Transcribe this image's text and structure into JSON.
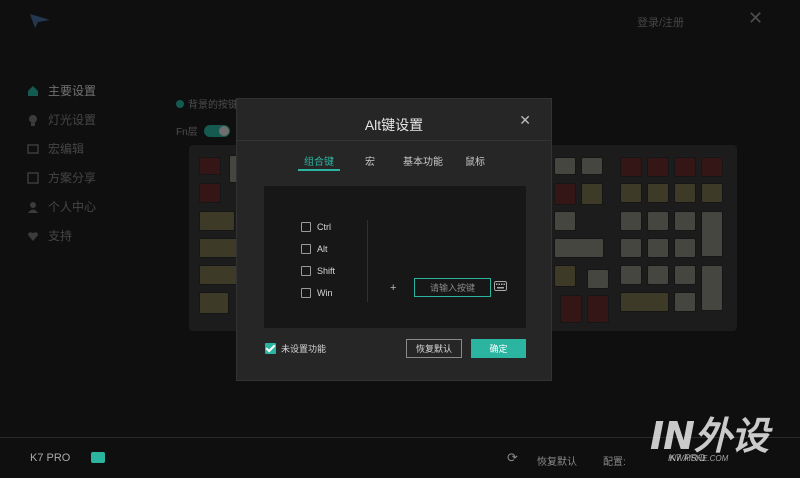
{
  "app": {
    "top_right_text": "登录/注册",
    "close_glyph": "✕"
  },
  "sidebar": {
    "items": [
      {
        "label": "主要设置",
        "icon": "home-icon",
        "active": true
      },
      {
        "label": "灯光设置",
        "icon": "light-icon",
        "active": false
      },
      {
        "label": "宏编辑",
        "icon": "macro-icon",
        "active": false
      },
      {
        "label": "方案分享",
        "icon": "share-icon",
        "active": false
      },
      {
        "label": "个人中心",
        "icon": "user-icon",
        "active": false
      },
      {
        "label": "支持",
        "icon": "support-icon",
        "active": false
      }
    ]
  },
  "options": {
    "backlight_label": "背景的按键",
    "fn_label": "Fn层"
  },
  "dialog": {
    "title": "Alt键设置",
    "close_glyph": "✕",
    "tabs": [
      {
        "label": "组合键",
        "active": true
      },
      {
        "label": "宏",
        "active": false
      },
      {
        "label": "基本功能",
        "active": false
      },
      {
        "label": "鼠标",
        "active": false
      }
    ],
    "modifiers": [
      {
        "label": "Ctrl",
        "checked": false
      },
      {
        "label": "Alt",
        "checked": false
      },
      {
        "label": "Shift",
        "checked": false
      },
      {
        "label": "Win",
        "checked": false
      }
    ],
    "plus_glyph": "+",
    "key_input_placeholder": "请输入按键",
    "unset_label": "未设置功能",
    "unset_checked": true,
    "reset_button": "恢复默认",
    "confirm_button": "确定"
  },
  "bottom": {
    "model": "K7 PRO",
    "restore_label": "恢复默认",
    "config_label": "配置:",
    "config_value": "K7 PRO"
  },
  "watermark": {
    "main": "IN外设",
    "sub": "INWAISHE.COM"
  },
  "colors": {
    "accent": "#2bb5a1",
    "background": "#1e1e1e",
    "dialog": "#262626"
  }
}
